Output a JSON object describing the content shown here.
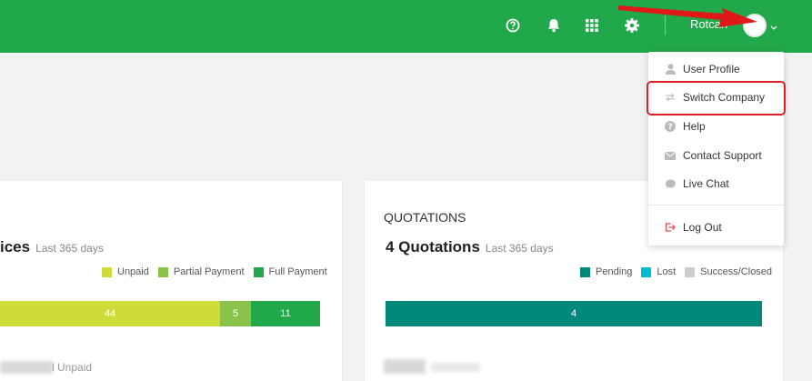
{
  "header": {
    "username": "Rotcari",
    "icons": [
      "help-icon",
      "bell-icon",
      "apps-grid-icon",
      "gear-icon"
    ],
    "brand_color": "#21a84a"
  },
  "user_menu": {
    "items": [
      {
        "label": "User Profile",
        "icon": "user-icon"
      },
      {
        "label": "Switch Company",
        "icon": "switch-icon"
      },
      {
        "label": "Help",
        "icon": "help-icon"
      },
      {
        "label": "Contact Support",
        "icon": "envelope-icon"
      },
      {
        "label": "Live Chat",
        "icon": "chat-icon"
      },
      {
        "label": "Log Out",
        "icon": "logout-icon"
      }
    ],
    "highlight_color": "#e02020"
  },
  "invoices_card": {
    "title": "ices",
    "subtitle": "Last 365 days",
    "legend": [
      {
        "label": "Unpaid",
        "color": "#cddc39"
      },
      {
        "label": "Partial Payment",
        "color": "#8bc34a"
      },
      {
        "label": "Full Payment",
        "color": "#21a84a"
      }
    ],
    "bar_values": [
      "44",
      "5",
      "11"
    ],
    "footer_label": "l Unpaid"
  },
  "quotations_card": {
    "heading": "QUOTATIONS",
    "title": "4 Quotations",
    "subtitle": "Last 365 days",
    "legend": [
      {
        "label": "Pending",
        "color": "#00897b"
      },
      {
        "label": "Lost",
        "color": "#00bcd4"
      },
      {
        "label": "Success/Closed",
        "color": "#cccccc"
      }
    ],
    "bar_values": [
      "4"
    ]
  }
}
